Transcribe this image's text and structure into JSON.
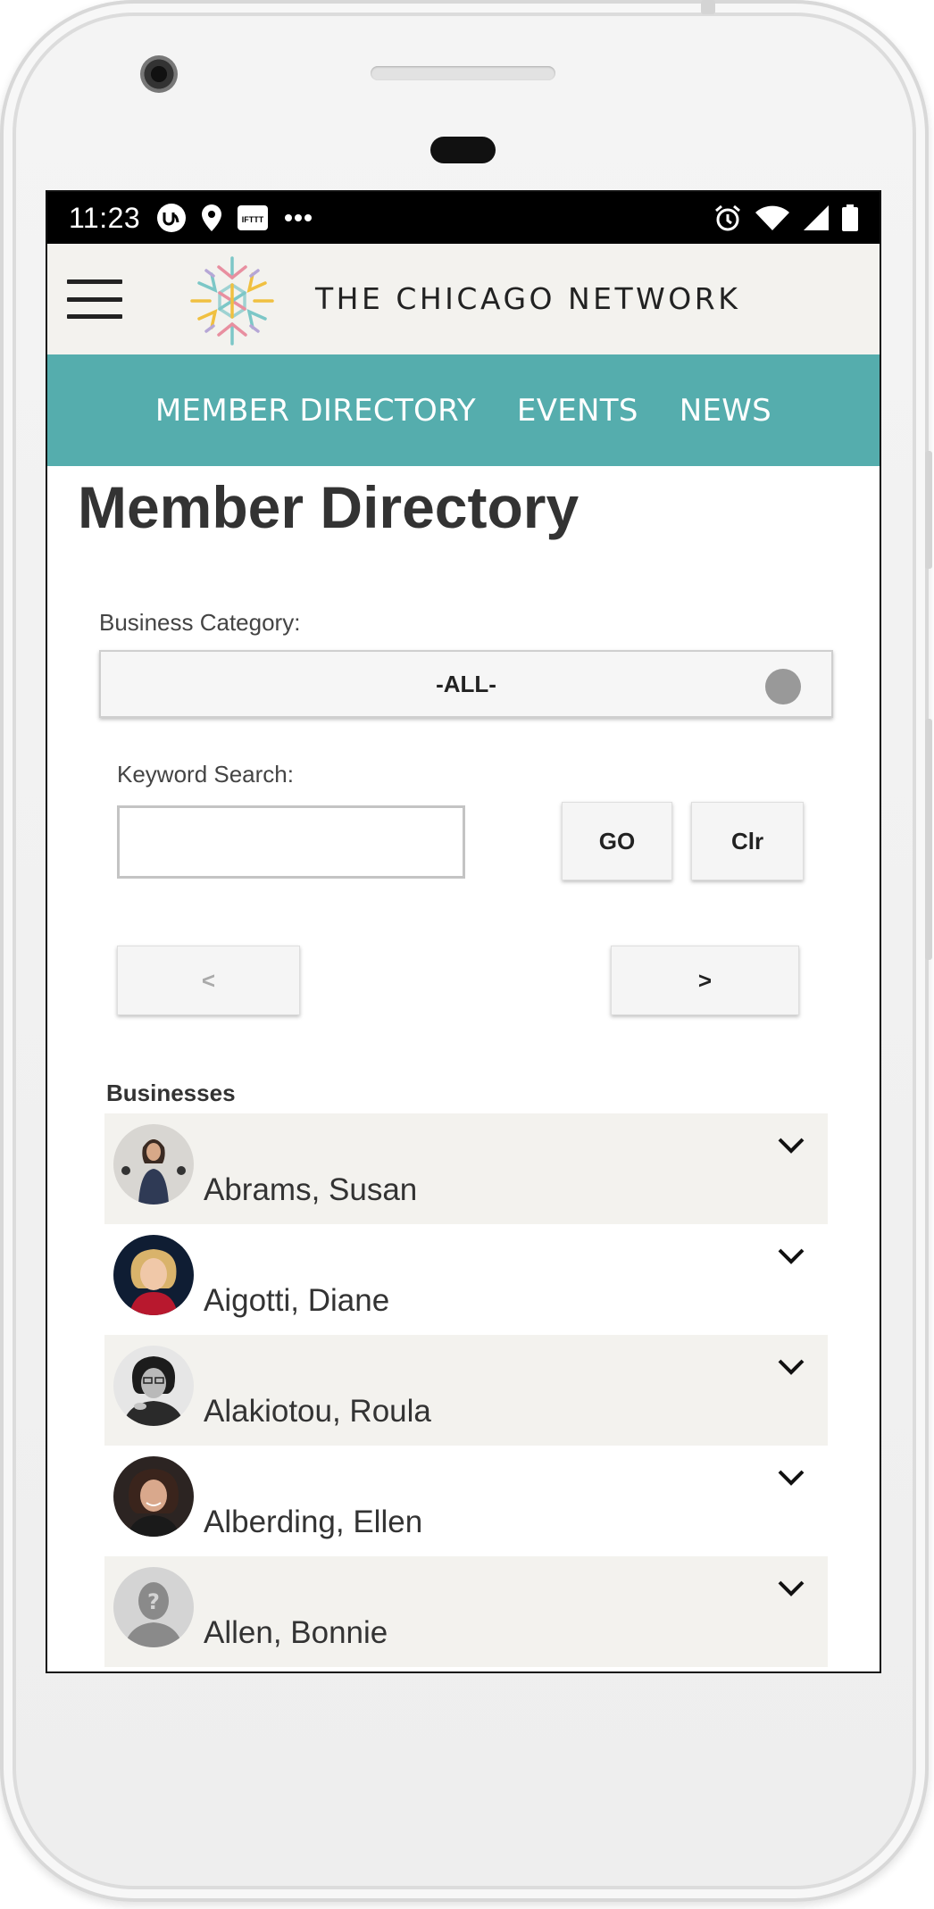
{
  "status_bar": {
    "time": "11:23",
    "left_icons": [
      "app-u-icon",
      "location-pin-icon",
      "ifttt-icon",
      "more-dots-icon"
    ],
    "right_icons": [
      "alarm-icon",
      "wifi-icon",
      "signal-icon",
      "battery-icon"
    ]
  },
  "header": {
    "brand": "THE CHICAGO NETWORK",
    "menu_icon": "hamburger-icon"
  },
  "nav": {
    "items": [
      {
        "label": "MEMBER DIRECTORY"
      },
      {
        "label": "EVENTS"
      },
      {
        "label": "NEWS"
      }
    ]
  },
  "page": {
    "title": "Member Directory",
    "category_label": "Business Category:",
    "category_value": "-ALL-",
    "keyword_label": "Keyword Search:",
    "keyword_value": "",
    "go_label": "GO",
    "clear_label": "Clr",
    "prev_label": "<",
    "next_label": ">",
    "businesses_label": "Businesses"
  },
  "businesses": [
    {
      "name": "Abrams, Susan"
    },
    {
      "name": "Aigotti, Diane"
    },
    {
      "name": "Alakiotou, Roula"
    },
    {
      "name": "Alberding, Ellen"
    },
    {
      "name": "Allen, Bonnie"
    }
  ],
  "colors": {
    "nav_bg": "#55adad",
    "header_bg": "#f3f2ee",
    "row_shade": "#f3f2ee"
  }
}
